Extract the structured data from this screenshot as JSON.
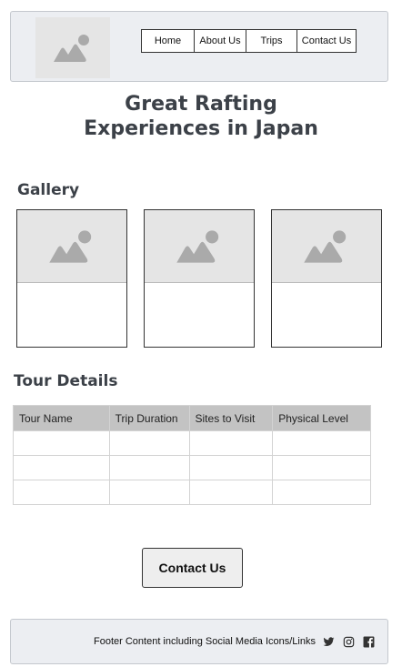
{
  "header": {
    "logo_icon": "image-placeholder-icon",
    "nav": [
      {
        "label": "Home"
      },
      {
        "label": "About Us"
      },
      {
        "label": "Trips"
      },
      {
        "label": "Contact Us"
      }
    ]
  },
  "hero": {
    "title": "Great Rafting Experiences in Japan"
  },
  "gallery": {
    "title": "Gallery",
    "card_icon": "image-placeholder-icon"
  },
  "tour_details": {
    "title": "Tour Details",
    "columns": [
      "Tour Name",
      "Trip Duration",
      "Sites to Visit",
      "Physical Level"
    ],
    "rows": [
      [
        "",
        "",
        "",
        ""
      ],
      [
        "",
        "",
        "",
        ""
      ],
      [
        "",
        "",
        "",
        ""
      ]
    ]
  },
  "cta": {
    "label": "Contact Us"
  },
  "footer": {
    "text": "Footer Content including Social Media Icons/Links",
    "icons": [
      "twitter-icon",
      "instagram-icon",
      "facebook-icon"
    ]
  },
  "colors": {
    "panel_bg": "#eceef2",
    "placeholder_bg": "#e5e5e5",
    "placeholder_icon": "#aaaaaa",
    "table_header_bg": "#c3c3c3",
    "heading_text": "#3c4148"
  }
}
